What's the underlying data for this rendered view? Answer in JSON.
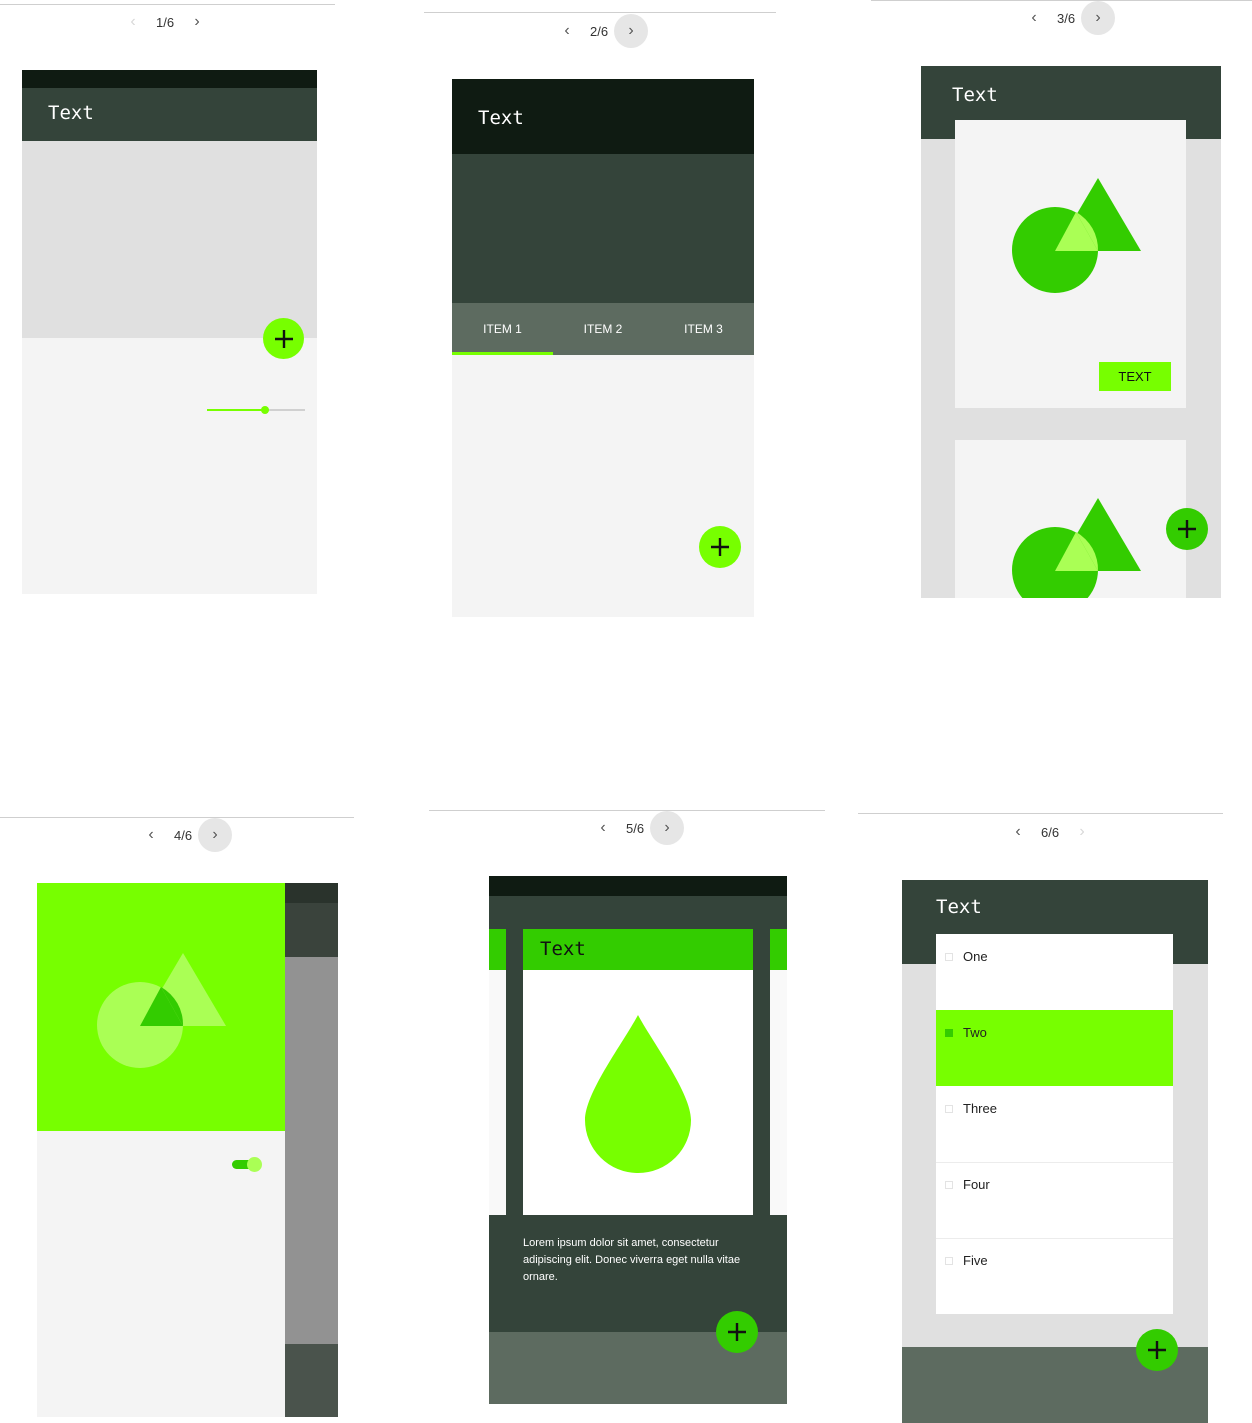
{
  "panels": [
    {
      "pager": "1/6",
      "title": "Text"
    },
    {
      "pager": "2/6",
      "title": "Text",
      "tabs": [
        "ITEM 1",
        "ITEM 2",
        "ITEM 3"
      ]
    },
    {
      "pager": "3/6",
      "title": "Text",
      "button": "TEXT"
    },
    {
      "pager": "4/6"
    },
    {
      "pager": "5/6",
      "title": "Text",
      "body": "Lorem ipsum dolor sit amet, consectetur adipiscing elit. Donec viverra eget nulla vitae ornare."
    },
    {
      "pager": "6/6",
      "title": "Text",
      "list": [
        "One",
        "Two",
        "Three",
        "Four",
        "Five"
      ]
    }
  ],
  "icons": {
    "prev": "chevron-left-icon",
    "next": "chevron-right-icon",
    "fab": "plus-icon"
  },
  "colors": {
    "dark": "#34443a",
    "darker": "#0f1b12",
    "mid": "#5d6b60",
    "lime": "#77ff00",
    "green": "#33cc00",
    "light_green": "#aaff55",
    "surface": "#f4f4f4",
    "neutral": "#e0e0e0"
  },
  "states": {
    "slider_value": 0.6,
    "switch_on": true,
    "selected_tab": 0,
    "selected_list_item": 1
  }
}
